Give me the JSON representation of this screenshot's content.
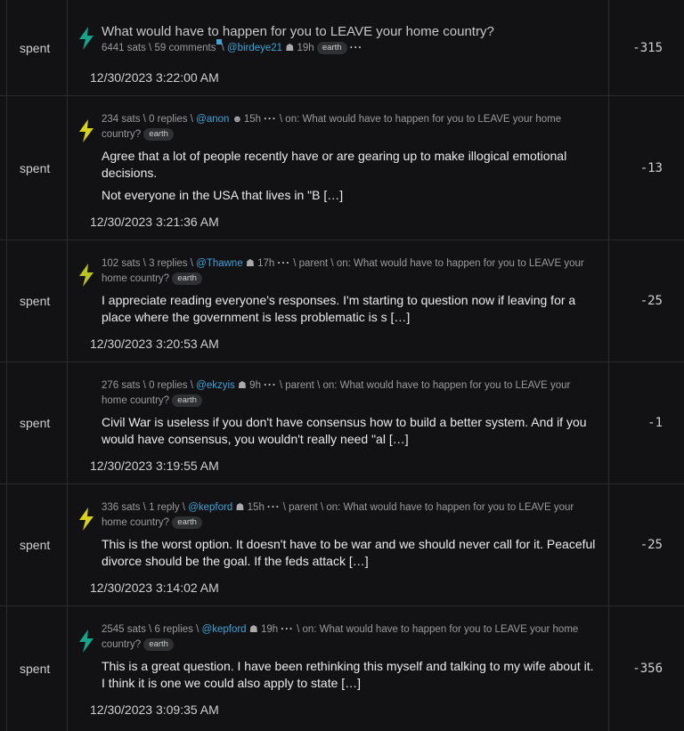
{
  "rows": [
    {
      "label": "spent",
      "value": "-315",
      "kind": "post",
      "bolt_color": "#17a38a",
      "title": "What would have to happen for you to LEAVE your home country?",
      "sats": "6441 sats",
      "comments": "59 comments",
      "user": "@birdeye21",
      "age": "19h",
      "tag": "earth",
      "timestamp": "12/30/2023 3:22:00 AM"
    },
    {
      "label": "spent",
      "value": "-13",
      "kind": "comment",
      "bolt_color": "#d8d21e",
      "sats": "234 sats",
      "replies": "0 replies",
      "user": "@anon",
      "age": "15h",
      "on_text": "on: What would have to happen for you to LEAVE your home",
      "on_text2": "country?",
      "tag": "earth",
      "body_lines": [
        "Agree that a lot of people recently have or are gearing up to make illogical emotional decisions.",
        "Not everyone in the USA that lives in \"B […]"
      ],
      "timestamp": "12/30/2023 3:21:36 AM"
    },
    {
      "label": "spent",
      "value": "-25",
      "kind": "comment",
      "bolt_color": "#b8c420",
      "sats": "102 sats",
      "replies": "3 replies",
      "user": "@Thawne",
      "age": "17h",
      "parent": "parent",
      "on_text": "on: What would have to happen for you to LEAVE your",
      "on_text2": "home country?",
      "tag": "earth",
      "body_lines": [
        "I appreciate reading everyone's responses. I'm starting to question now if leaving for a place where the government is less problematic is s […]"
      ],
      "timestamp": "12/30/2023 3:20:53 AM"
    },
    {
      "label": "spent",
      "value": "-1",
      "kind": "comment",
      "bolt_color": "",
      "sats": "276 sats",
      "replies": "0 replies",
      "user": "@ekzyis",
      "age": "9h",
      "parent": "parent",
      "on_text": "on: What would have to happen for you to LEAVE your",
      "on_text2": "home country?",
      "tag": "earth",
      "body_lines": [
        "Civil War is useless if you don't have consensus how to build a better system. And if you would have consensus, you wouldn't really need \"al […]"
      ],
      "timestamp": "12/30/2023 3:19:55 AM"
    },
    {
      "label": "spent",
      "value": "-25",
      "kind": "comment",
      "bolt_color": "#d8d21e",
      "sats": "336 sats",
      "replies": "1 reply",
      "user": "@kepford",
      "age": "15h",
      "parent": "parent",
      "on_text": "on: What would have to happen for you to LEAVE your",
      "on_text2": "home country?",
      "tag": "earth",
      "body_lines": [
        "This is the worst option. It doesn't have to be war and we should never call for it. Peaceful divorce should be the goal. If the feds attack […]"
      ],
      "timestamp": "12/30/2023 3:14:02 AM"
    },
    {
      "label": "spent",
      "value": "-356",
      "kind": "comment",
      "bolt_color": "#17a38a",
      "sats": "2545 sats",
      "replies": "6 replies",
      "user": "@kepford",
      "age": "19h",
      "on_text": "on: What would have to happen for you to LEAVE your home",
      "on_text2": "country?",
      "tag": "earth",
      "body_lines": [
        "This is a great question. I have been rethinking this myself and talking to my wife about it. I think it is one we could also apply to state […]"
      ],
      "timestamp": "12/30/2023 3:09:35 AM"
    }
  ]
}
